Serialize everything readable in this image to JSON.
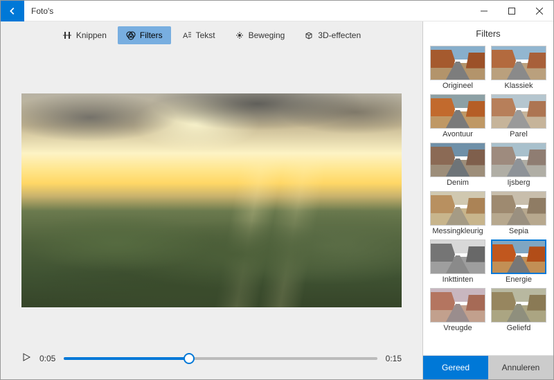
{
  "window": {
    "title": "Foto's"
  },
  "toolbar": {
    "trim": {
      "label": "Knippen"
    },
    "filters": {
      "label": "Filters"
    },
    "text": {
      "label": "Tekst"
    },
    "motion": {
      "label": "Beweging"
    },
    "fx3d": {
      "label": "3D-effecten"
    }
  },
  "player": {
    "current_time": "0:05",
    "duration": "0:15"
  },
  "panel": {
    "title": "Filters",
    "done": "Gereed",
    "cancel": "Annuleren"
  },
  "filters": {
    "origineel": {
      "label": "Origineel"
    },
    "klassiek": {
      "label": "Klassiek"
    },
    "avontuur": {
      "label": "Avontuur"
    },
    "parel": {
      "label": "Parel"
    },
    "denim": {
      "label": "Denim"
    },
    "ijsberg": {
      "label": "Ijsberg"
    },
    "messingkleurig": {
      "label": "Messingkleurig"
    },
    "sepia": {
      "label": "Sepia"
    },
    "inkttinten": {
      "label": "Inkttinten"
    },
    "energie": {
      "label": "Energie"
    },
    "vreugde": {
      "label": "Vreugde"
    },
    "geliefd": {
      "label": "Geliefd"
    }
  },
  "selected_filter": "energie"
}
